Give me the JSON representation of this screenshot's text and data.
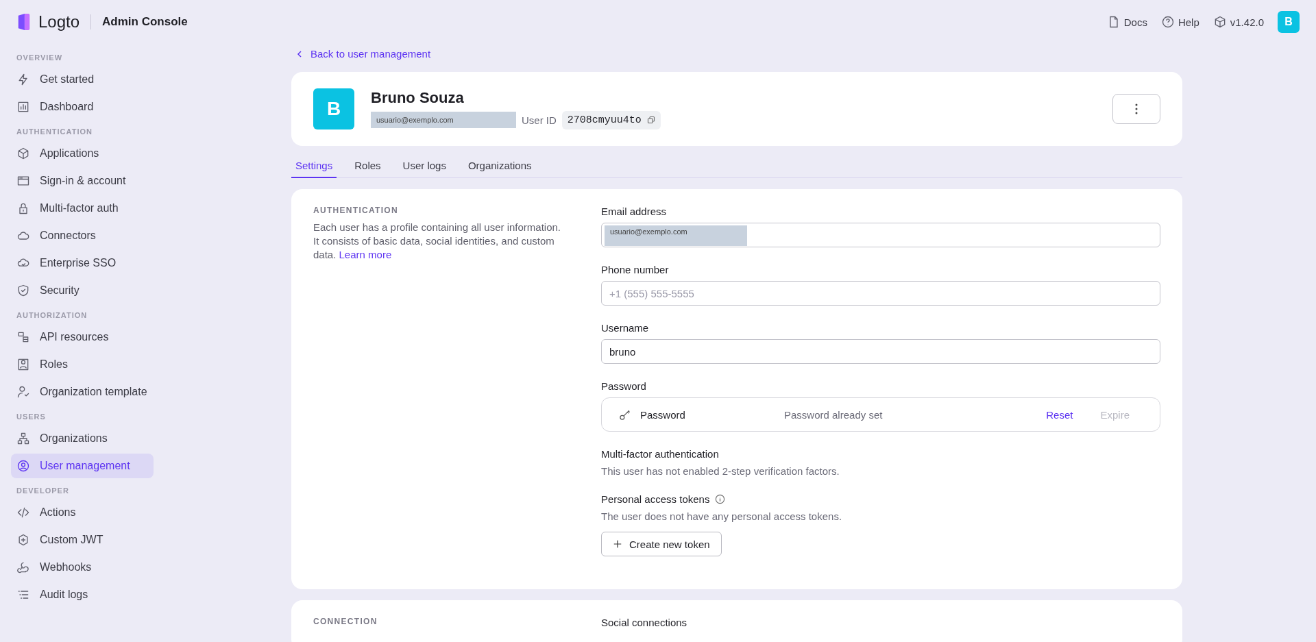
{
  "header": {
    "brand": "Logto",
    "product": "Admin Console",
    "links": [
      {
        "label": "Docs"
      },
      {
        "label": "Help"
      },
      {
        "label": "v1.42.0"
      }
    ],
    "avatar": "B"
  },
  "sidebar": {
    "sections": [
      {
        "title": "OVERVIEW",
        "items": [
          {
            "label": "Get started",
            "selected": false
          },
          {
            "label": "Dashboard",
            "selected": false
          }
        ]
      },
      {
        "title": "AUTHENTICATION",
        "items": [
          {
            "label": "Applications",
            "selected": false
          },
          {
            "label": "Sign-in & account",
            "selected": false
          },
          {
            "label": "Multi-factor auth",
            "selected": false
          },
          {
            "label": "Connectors",
            "selected": false
          },
          {
            "label": "Enterprise SSO",
            "selected": false
          },
          {
            "label": "Security",
            "selected": false
          }
        ]
      },
      {
        "title": "AUTHORIZATION",
        "items": [
          {
            "label": "API resources",
            "selected": false
          },
          {
            "label": "Roles",
            "selected": false
          },
          {
            "label": "Organization template",
            "selected": false
          }
        ]
      },
      {
        "title": "USERS",
        "items": [
          {
            "label": "Organizations",
            "selected": false
          },
          {
            "label": "User management",
            "selected": true
          }
        ]
      },
      {
        "title": "DEVELOPER",
        "items": [
          {
            "label": "Actions",
            "selected": false
          },
          {
            "label": "Custom JWT",
            "selected": false
          },
          {
            "label": "Webhooks",
            "selected": false
          },
          {
            "label": "Audit logs",
            "selected": false
          }
        ]
      }
    ]
  },
  "back_link": "Back to user management",
  "user": {
    "avatar": "B",
    "name": "Bruno Souza",
    "email": "usuario@exemplo.com",
    "id_label": "User ID",
    "id": "2708cmyuu4to"
  },
  "tabs": [
    {
      "label": "Settings",
      "selected": true
    },
    {
      "label": "Roles",
      "selected": false
    },
    {
      "label": "User logs",
      "selected": false
    },
    {
      "label": "Organizations",
      "selected": false
    }
  ],
  "authentication": {
    "heading": "AUTHENTICATION",
    "description": "Each user has a profile containing all user information. It consists of basic data, social identities, and custom data.",
    "learn_more": "Learn more",
    "fields": [
      {
        "label": "Email address",
        "value": "usuario@exemplo.com",
        "redacted": true
      },
      {
        "label": "Phone number",
        "placeholder": "+1 (555) 555-5555"
      },
      {
        "label": "Username",
        "value": "bruno"
      }
    ],
    "password": {
      "label": "Password",
      "name": "Password",
      "status": "Password already set",
      "actions": [
        {
          "label": "Reset",
          "disabled": false
        },
        {
          "label": "Expire",
          "disabled": true
        }
      ]
    },
    "mfa": {
      "label": "Multi-factor authentication",
      "text": "This user has not enabled 2-step verification factors."
    },
    "tokens": {
      "label": "Personal access tokens",
      "text": "The user does not have any personal access tokens.",
      "button": "Create new token"
    }
  },
  "connection": {
    "heading": "CONNECTION",
    "social_label": "Social connections"
  }
}
